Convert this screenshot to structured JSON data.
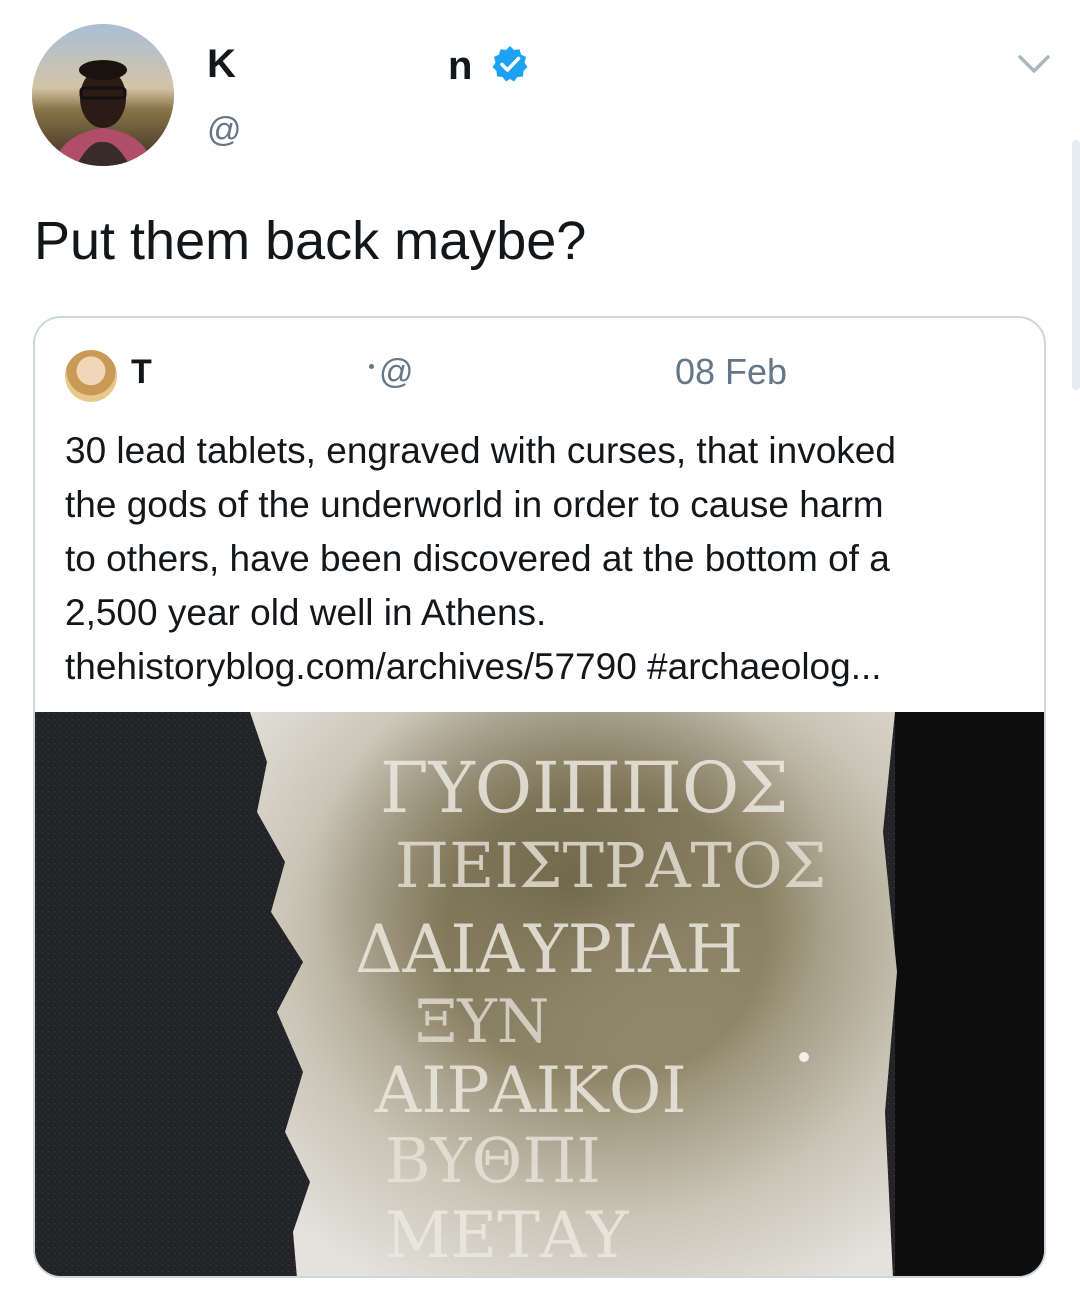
{
  "author": {
    "name_first": "K",
    "name_last": "n",
    "handle": "@",
    "verified_color": "#1da1f2"
  },
  "tweet": {
    "text": "Put them back maybe?"
  },
  "quoted": {
    "name": "T",
    "handle": "@",
    "date": "08 Feb",
    "text_lines": [
      "30 lead tablets, engraved with curses, that invoked",
      "the gods of the underworld in order to cause harm",
      "to others, have been discovered at the bottom of a",
      "2,500 year old well in Athens.",
      "thehistoryblog.com/archives/57790 #archaeolog..."
    ],
    "image_inscription": [
      "ΓΥΟΙΠΠΟΣ",
      "ΠΕΙΣΤΡΑΤΟΣ",
      "ΔΑΙΑΥΡΙΑΗ",
      "ΞΥΝ",
      "ΑΙΡΑΙΚΟΙ",
      "ΒΥΘΠΙ",
      "ΜΕΤΑΥ"
    ]
  },
  "icons": {
    "verified": "verified-badge-icon",
    "menu": "chevron-down-icon"
  },
  "colors": {
    "text": "#14171a",
    "secondary": "#657786",
    "border": "#ccd6dd"
  }
}
